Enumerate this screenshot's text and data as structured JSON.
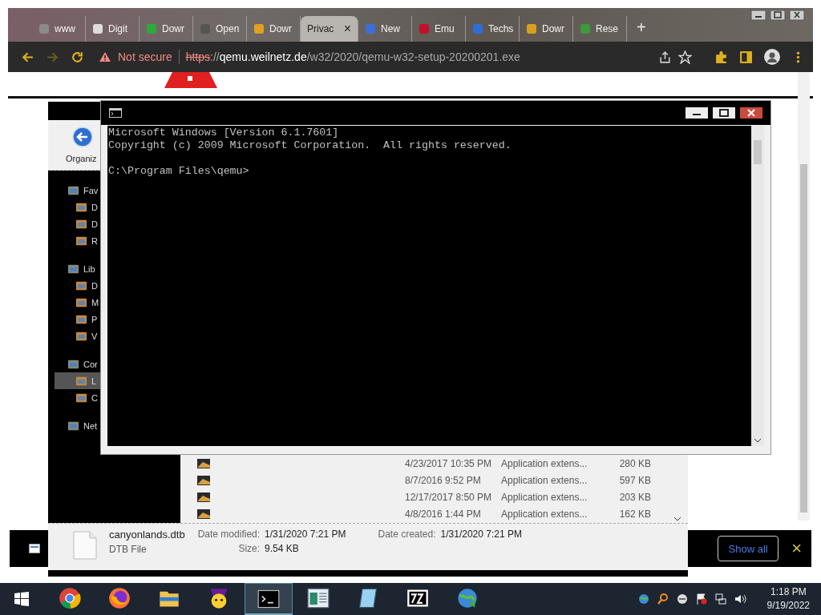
{
  "browser": {
    "tabs": [
      {
        "label": "www",
        "kind": "globe",
        "selected": false
      },
      {
        "label": "Digit",
        "kind": "bank",
        "selected": false
      },
      {
        "label": "Dowr",
        "kind": "play",
        "selected": false
      },
      {
        "label": "Open",
        "kind": "folder",
        "selected": false
      },
      {
        "label": "Dowr",
        "kind": "download",
        "selected": false
      },
      {
        "label": "Privac",
        "kind": "none",
        "selected": true,
        "close": "×"
      },
      {
        "label": "New",
        "kind": "puzzle",
        "selected": false
      },
      {
        "label": "Emu",
        "kind": "alpha",
        "selected": false
      },
      {
        "label": "Techs",
        "kind": "triangle",
        "selected": false
      },
      {
        "label": "Dowr",
        "kind": "star",
        "selected": false
      },
      {
        "label": "Rese",
        "kind": "aj",
        "selected": false
      }
    ],
    "new_tab": "+",
    "toolbar": {
      "security": "Not secure",
      "url": {
        "scheme": "https",
        "separator": "://",
        "host": "qemu.weilnetz.de",
        "path": "/w32/2020/qemu-w32-setup-20200201.exe"
      }
    }
  },
  "explorer": {
    "toolbar_label": "Organiz",
    "nav": [
      {
        "label": "Fav",
        "kind": "group",
        "selected": false
      },
      {
        "label": "D",
        "kind": "item",
        "selected": false
      },
      {
        "label": "D",
        "kind": "item",
        "selected": false
      },
      {
        "label": "R",
        "kind": "item",
        "selected": false
      },
      {
        "label": "Lib",
        "kind": "group",
        "selected": false
      },
      {
        "label": "D",
        "kind": "item",
        "selected": false
      },
      {
        "label": "M",
        "kind": "item",
        "selected": false
      },
      {
        "label": "P",
        "kind": "item",
        "selected": false
      },
      {
        "label": "V",
        "kind": "item",
        "selected": false
      },
      {
        "label": "Cor",
        "kind": "group",
        "selected": false
      },
      {
        "label": "L",
        "kind": "item",
        "selected": true
      },
      {
        "label": "C",
        "kind": "item",
        "selected": false
      },
      {
        "label": "Net",
        "kind": "group",
        "selected": false
      }
    ],
    "files": [
      {
        "date": "4/23/2017 10:35 PM",
        "type": "Application extens...",
        "size": "280 KB"
      },
      {
        "date": "8/7/2016 9:52 PM",
        "type": "Application extens...",
        "size": "597 KB"
      },
      {
        "date": "12/17/2017 8:50 PM",
        "type": "Application extens...",
        "size": "203 KB"
      },
      {
        "date": "4/8/2016 1:44 PM",
        "type": "Application extens...",
        "size": "162 KB"
      }
    ],
    "details": {
      "name": "canyonlands.dtb",
      "type": "DTB File",
      "modified_label": "Date modified:",
      "modified": "1/31/2020 7:21 PM",
      "created_label": "Date created:",
      "created": "1/31/2020 7:21 PM",
      "size_label": "Size:",
      "size": "9.54 KB"
    }
  },
  "download_bar": {
    "button": "Show all",
    "close": "×"
  },
  "console": {
    "blocks": [
      {
        "lines": [
          "Microsoft Windows [Version 6.1.7601]",
          "Copyright (c) 2009 Microsoft Corporation.  All rights reserved."
        ]
      },
      {
        "lines": [
          "C:\\Program Files\\qemu>"
        ]
      }
    ]
  },
  "taskbar": {
    "apps": [
      {
        "kind": "chrome",
        "active": false
      },
      {
        "kind": "firefox",
        "active": false
      },
      {
        "kind": "folder",
        "active": false
      },
      {
        "kind": "messenger",
        "active": false
      },
      {
        "kind": "console",
        "active": true
      },
      {
        "kind": "window",
        "active": false
      },
      {
        "kind": "notepad",
        "active": false
      },
      {
        "kind": "archive",
        "active": false
      },
      {
        "kind": "globe",
        "active": false
      }
    ],
    "clock": {
      "time": "1:18 PM",
      "date": "9/19/2022"
    }
  }
}
